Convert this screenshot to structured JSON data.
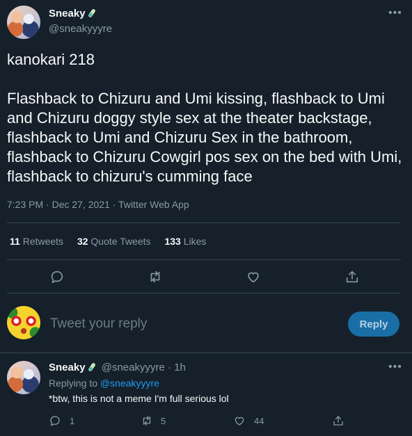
{
  "tweet": {
    "author_name": "Sneaky",
    "author_handle": "@sneakyyyre",
    "text_line1": "kanokari 218",
    "text_body": "Flashback to Chizuru and Umi kissing, flashback to Umi and Chizuru doggy style sex at the theater backstage, flashback to Umi and Chizuru Sex in the bathroom, flashback to Chizuru Cowgirl pos sex on the bed with Umi, flashback to chizuru's cumming face",
    "timestamp": "7:23 PM · Dec 27, 2021 · Twitter Web App",
    "stats": {
      "retweets_count": "11",
      "retweets_label": "Retweets",
      "quotes_count": "32",
      "quotes_label": "Quote Tweets",
      "likes_count": "133",
      "likes_label": "Likes"
    }
  },
  "reply_box": {
    "placeholder": "Tweet your reply",
    "button_label": "Reply"
  },
  "reply": {
    "author_name": "Sneaky",
    "author_handle": "@sneakyyyre",
    "time": "· 1h",
    "replying_to_label": "Replying to",
    "replying_to_handle": "@sneakyyyre",
    "text": "*btw, this is not a meme I'm full serious lol",
    "reply_count": "1",
    "retweet_count": "5",
    "like_count": "44"
  },
  "colors": {
    "background": "#15202b",
    "accent": "#1d9bf0",
    "muted": "#8b98a5",
    "divider": "#38444d"
  }
}
